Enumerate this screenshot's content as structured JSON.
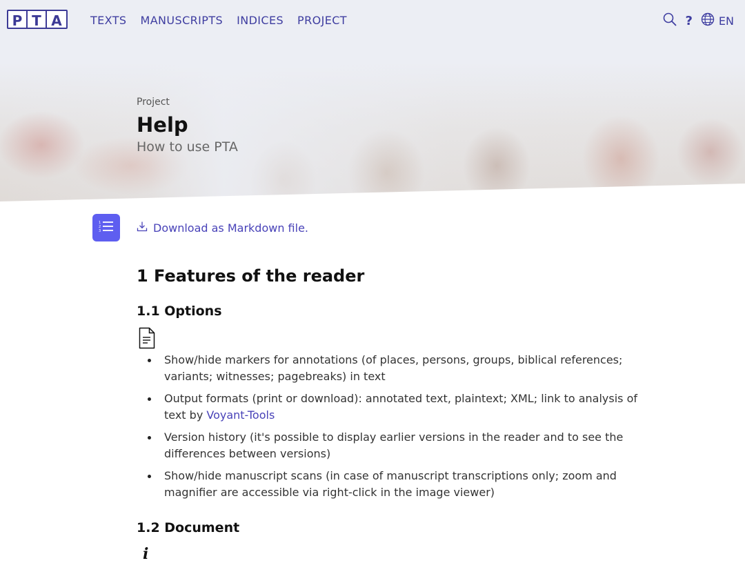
{
  "logo": {
    "letters": [
      "P",
      "T",
      "A"
    ]
  },
  "nav": {
    "items": [
      "TEXTS",
      "MANUSCRIPTS",
      "INDICES",
      "PROJECT"
    ]
  },
  "tools": {
    "search_icon": "search-icon",
    "help_label": "?",
    "language_icon": "globe-icon",
    "language_label": "EN"
  },
  "hero": {
    "breadcrumb": "Project",
    "title": "Help",
    "subtitle": "How to use PTA"
  },
  "content": {
    "toc_icon": "numbered-list-icon",
    "download_icon": "download-icon",
    "download_label": "Download as Markdown file.",
    "section_1_title": "1 Features of the reader",
    "section_1_1_title": "1.1 Options",
    "section_1_1_icon": "document-icon",
    "features": [
      {
        "text": "Show/hide markers for annotations (of places, persons, groups, biblical references; variants; witnesses; pagebreaks) in text"
      },
      {
        "text": "Output formats (print or download): annotated text, plaintext; XML; link to analysis of text by ",
        "link": "Voyant-Tools"
      },
      {
        "text": "Version history (it's possible to display earlier versions in the reader and to see the differences between versions)"
      },
      {
        "text": "Show/hide manuscript scans (in case of manuscript transcriptions only; zoom and magnifier are accessible via right-click in the image viewer)"
      }
    ],
    "section_1_2_title": "1.2 Document",
    "section_1_2_icon_label": "i"
  },
  "colors": {
    "accent": "#3e3da0",
    "toc_button": "#5e5ef0",
    "link": "#4842b8"
  }
}
